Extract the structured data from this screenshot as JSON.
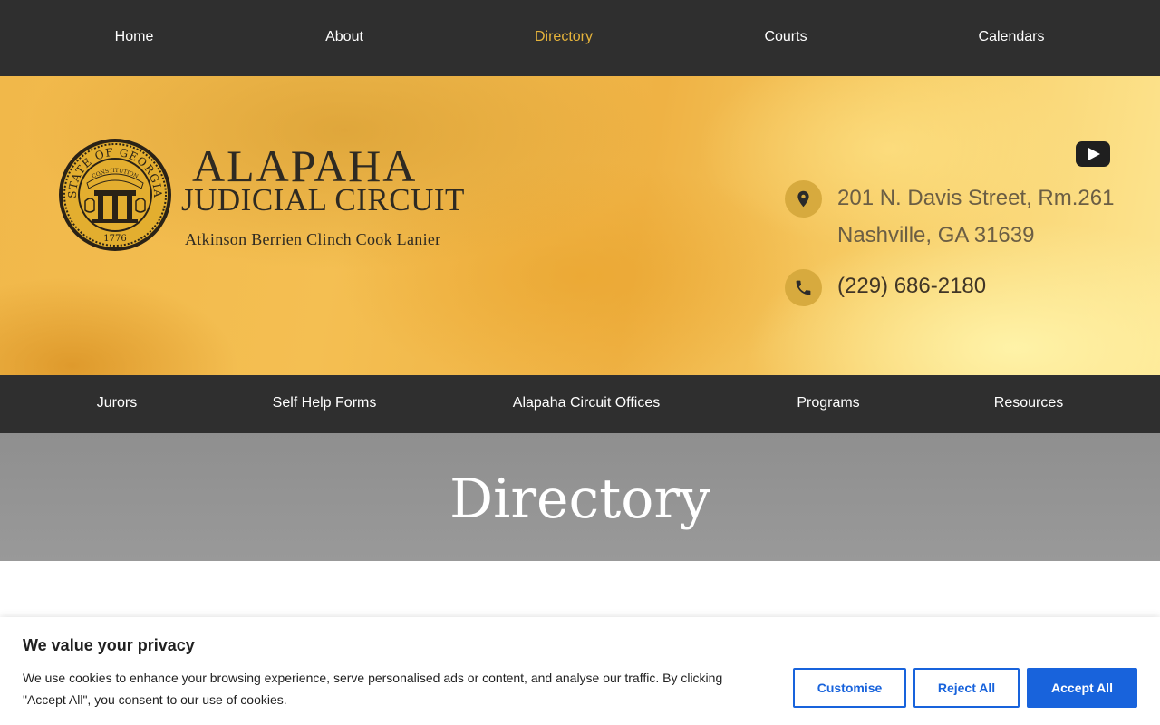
{
  "top_nav": {
    "items": [
      {
        "label": "Home"
      },
      {
        "label": "About"
      },
      {
        "label": "Directory",
        "active": true
      },
      {
        "label": "Courts"
      },
      {
        "label": "Calendars"
      }
    ]
  },
  "header": {
    "seal_text": {
      "top": "STATE OF GEORGIA",
      "banner": "CONSTITUTION",
      "year": "1776"
    },
    "title": "ALAPAHA",
    "subtitle": "JUDICIAL CIRCUIT",
    "counties": "Atkinson Berrien Clinch Cook Lanier",
    "address_line1": "201 N. Davis Street, Rm.261",
    "address_line2": "Nashville, GA 31639",
    "phone": "(229) 686-2180"
  },
  "sub_nav": {
    "items": [
      {
        "label": "Jurors"
      },
      {
        "label": "Self Help Forms"
      },
      {
        "label": "Alapaha Circuit Offices"
      },
      {
        "label": "Programs"
      },
      {
        "label": "Resources"
      }
    ]
  },
  "page": {
    "title": "Directory"
  },
  "cookie": {
    "title": "We value your privacy",
    "text": "We use cookies to enhance your browsing experience, serve personalised ads or content, and analyse our traffic. By clicking \"Accept All\", you consent to our use of cookies.",
    "customise_label": "Customise",
    "reject_label": "Reject All",
    "accept_label": "Accept All"
  },
  "colors": {
    "nav_bg": "#2f2f2f",
    "active_link": "#e5b33b",
    "accent_blue": "#1863dc",
    "icon_circle": "#d7aa3e"
  },
  "icons": {
    "location": "map-pin-icon",
    "phone": "phone-icon",
    "youtube": "youtube-icon"
  }
}
